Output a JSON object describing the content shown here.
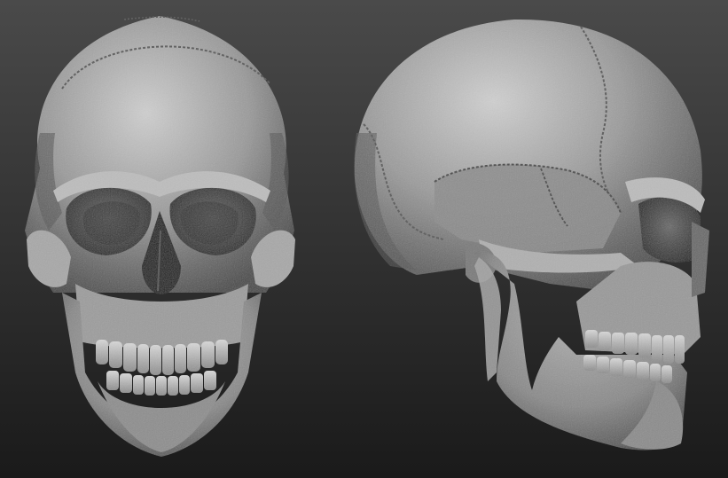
{
  "scene": {
    "subject": "",
    "views": [
      {
        "name": "front-view"
      },
      {
        "name": "side-view"
      }
    ]
  },
  "colors": {
    "background_top": "#4a4a4a",
    "background_bottom": "#1a1a1a",
    "bone_highlight": "#cfcfcf",
    "bone_mid": "#8f8f8f",
    "bone_shadow": "#3a3a3a",
    "cavity": "#1c1c1c"
  }
}
